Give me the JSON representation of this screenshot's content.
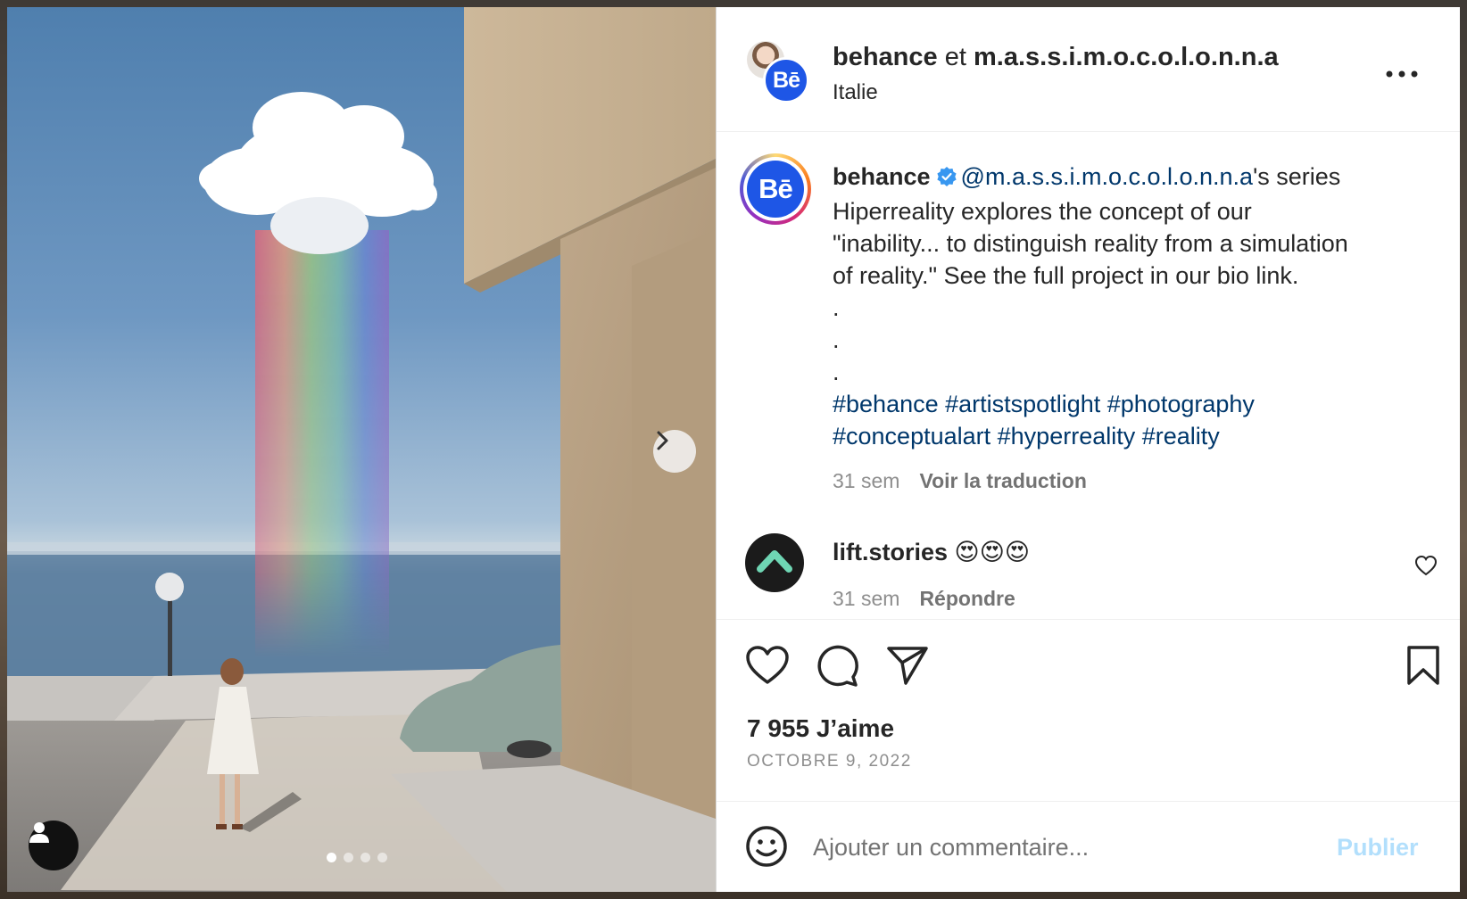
{
  "header": {
    "account": "behance",
    "connector": "et",
    "collaborator": "m.a.s.s.i.m.o.c.o.l.o.n.n.a",
    "location": "Italie",
    "avatar_back_icon": "person-photo-icon",
    "avatar_front_label": "Bē"
  },
  "caption": {
    "avatar_label": "Bē",
    "user": "behance",
    "mention": "@m.a.s.s.i.m.o.c.o.l.o.n.n.a",
    "text_line1": "'s series",
    "text_line2": "Hiperreality explores the concept of our",
    "text_line3": "\"inability... to distinguish reality from a simulation",
    "text_line4": "of reality.\" See the full project in our bio link.",
    "dot": ".",
    "tags_line1": [
      "#behance",
      "#artistspotlight",
      "#photography"
    ],
    "tags_line2": [
      "#conceptualart",
      "#hyperreality",
      "#reality"
    ],
    "age": "31 sem",
    "translate": "Voir la traduction"
  },
  "comment": {
    "user": "lift.stories",
    "text": "😍😍😍",
    "age": "31 sem",
    "reply": "Répondre"
  },
  "stats": {
    "likes": "7 955 J’aime",
    "date": "OCTOBRE 9, 2022"
  },
  "add_comment": {
    "placeholder": "Ajouter un commentaire...",
    "publish": "Publier"
  },
  "carousel": {
    "slides": 4,
    "active": 0
  },
  "colors": {
    "brand_blue": "#1e56e6",
    "link_blue": "#00376b",
    "muted": "#8e8e8e",
    "publish_disabled": "#b2dffc"
  }
}
